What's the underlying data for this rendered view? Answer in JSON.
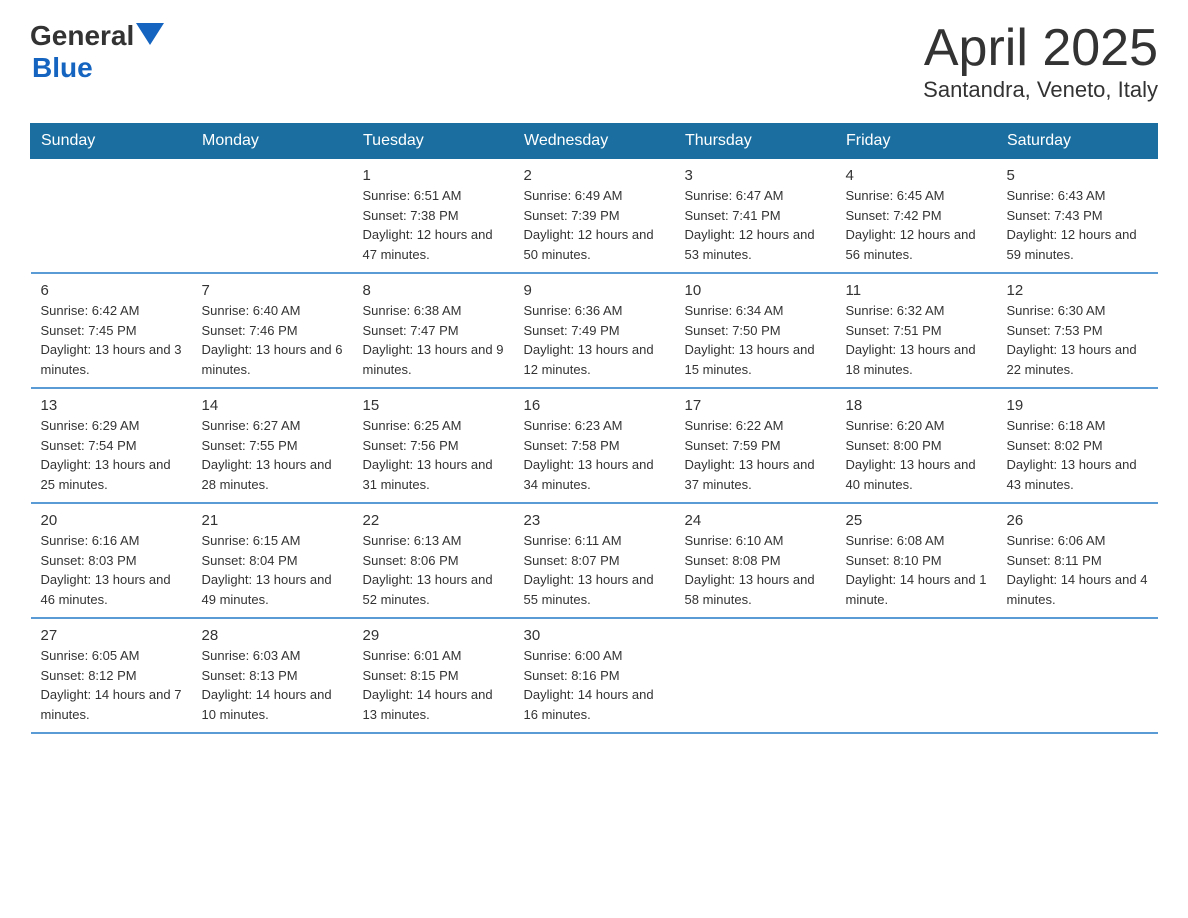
{
  "logo": {
    "general": "General",
    "blue": "Blue"
  },
  "title": "April 2025",
  "subtitle": "Santandra, Veneto, Italy",
  "headers": [
    "Sunday",
    "Monday",
    "Tuesday",
    "Wednesday",
    "Thursday",
    "Friday",
    "Saturday"
  ],
  "weeks": [
    [
      {
        "day": "",
        "sunrise": "",
        "sunset": "",
        "daylight": ""
      },
      {
        "day": "",
        "sunrise": "",
        "sunset": "",
        "daylight": ""
      },
      {
        "day": "1",
        "sunrise": "Sunrise: 6:51 AM",
        "sunset": "Sunset: 7:38 PM",
        "daylight": "Daylight: 12 hours and 47 minutes."
      },
      {
        "day": "2",
        "sunrise": "Sunrise: 6:49 AM",
        "sunset": "Sunset: 7:39 PM",
        "daylight": "Daylight: 12 hours and 50 minutes."
      },
      {
        "day": "3",
        "sunrise": "Sunrise: 6:47 AM",
        "sunset": "Sunset: 7:41 PM",
        "daylight": "Daylight: 12 hours and 53 minutes."
      },
      {
        "day": "4",
        "sunrise": "Sunrise: 6:45 AM",
        "sunset": "Sunset: 7:42 PM",
        "daylight": "Daylight: 12 hours and 56 minutes."
      },
      {
        "day": "5",
        "sunrise": "Sunrise: 6:43 AM",
        "sunset": "Sunset: 7:43 PM",
        "daylight": "Daylight: 12 hours and 59 minutes."
      }
    ],
    [
      {
        "day": "6",
        "sunrise": "Sunrise: 6:42 AM",
        "sunset": "Sunset: 7:45 PM",
        "daylight": "Daylight: 13 hours and 3 minutes."
      },
      {
        "day": "7",
        "sunrise": "Sunrise: 6:40 AM",
        "sunset": "Sunset: 7:46 PM",
        "daylight": "Daylight: 13 hours and 6 minutes."
      },
      {
        "day": "8",
        "sunrise": "Sunrise: 6:38 AM",
        "sunset": "Sunset: 7:47 PM",
        "daylight": "Daylight: 13 hours and 9 minutes."
      },
      {
        "day": "9",
        "sunrise": "Sunrise: 6:36 AM",
        "sunset": "Sunset: 7:49 PM",
        "daylight": "Daylight: 13 hours and 12 minutes."
      },
      {
        "day": "10",
        "sunrise": "Sunrise: 6:34 AM",
        "sunset": "Sunset: 7:50 PM",
        "daylight": "Daylight: 13 hours and 15 minutes."
      },
      {
        "day": "11",
        "sunrise": "Sunrise: 6:32 AM",
        "sunset": "Sunset: 7:51 PM",
        "daylight": "Daylight: 13 hours and 18 minutes."
      },
      {
        "day": "12",
        "sunrise": "Sunrise: 6:30 AM",
        "sunset": "Sunset: 7:53 PM",
        "daylight": "Daylight: 13 hours and 22 minutes."
      }
    ],
    [
      {
        "day": "13",
        "sunrise": "Sunrise: 6:29 AM",
        "sunset": "Sunset: 7:54 PM",
        "daylight": "Daylight: 13 hours and 25 minutes."
      },
      {
        "day": "14",
        "sunrise": "Sunrise: 6:27 AM",
        "sunset": "Sunset: 7:55 PM",
        "daylight": "Daylight: 13 hours and 28 minutes."
      },
      {
        "day": "15",
        "sunrise": "Sunrise: 6:25 AM",
        "sunset": "Sunset: 7:56 PM",
        "daylight": "Daylight: 13 hours and 31 minutes."
      },
      {
        "day": "16",
        "sunrise": "Sunrise: 6:23 AM",
        "sunset": "Sunset: 7:58 PM",
        "daylight": "Daylight: 13 hours and 34 minutes."
      },
      {
        "day": "17",
        "sunrise": "Sunrise: 6:22 AM",
        "sunset": "Sunset: 7:59 PM",
        "daylight": "Daylight: 13 hours and 37 minutes."
      },
      {
        "day": "18",
        "sunrise": "Sunrise: 6:20 AM",
        "sunset": "Sunset: 8:00 PM",
        "daylight": "Daylight: 13 hours and 40 minutes."
      },
      {
        "day": "19",
        "sunrise": "Sunrise: 6:18 AM",
        "sunset": "Sunset: 8:02 PM",
        "daylight": "Daylight: 13 hours and 43 minutes."
      }
    ],
    [
      {
        "day": "20",
        "sunrise": "Sunrise: 6:16 AM",
        "sunset": "Sunset: 8:03 PM",
        "daylight": "Daylight: 13 hours and 46 minutes."
      },
      {
        "day": "21",
        "sunrise": "Sunrise: 6:15 AM",
        "sunset": "Sunset: 8:04 PM",
        "daylight": "Daylight: 13 hours and 49 minutes."
      },
      {
        "day": "22",
        "sunrise": "Sunrise: 6:13 AM",
        "sunset": "Sunset: 8:06 PM",
        "daylight": "Daylight: 13 hours and 52 minutes."
      },
      {
        "day": "23",
        "sunrise": "Sunrise: 6:11 AM",
        "sunset": "Sunset: 8:07 PM",
        "daylight": "Daylight: 13 hours and 55 minutes."
      },
      {
        "day": "24",
        "sunrise": "Sunrise: 6:10 AM",
        "sunset": "Sunset: 8:08 PM",
        "daylight": "Daylight: 13 hours and 58 minutes."
      },
      {
        "day": "25",
        "sunrise": "Sunrise: 6:08 AM",
        "sunset": "Sunset: 8:10 PM",
        "daylight": "Daylight: 14 hours and 1 minute."
      },
      {
        "day": "26",
        "sunrise": "Sunrise: 6:06 AM",
        "sunset": "Sunset: 8:11 PM",
        "daylight": "Daylight: 14 hours and 4 minutes."
      }
    ],
    [
      {
        "day": "27",
        "sunrise": "Sunrise: 6:05 AM",
        "sunset": "Sunset: 8:12 PM",
        "daylight": "Daylight: 14 hours and 7 minutes."
      },
      {
        "day": "28",
        "sunrise": "Sunrise: 6:03 AM",
        "sunset": "Sunset: 8:13 PM",
        "daylight": "Daylight: 14 hours and 10 minutes."
      },
      {
        "day": "29",
        "sunrise": "Sunrise: 6:01 AM",
        "sunset": "Sunset: 8:15 PM",
        "daylight": "Daylight: 14 hours and 13 minutes."
      },
      {
        "day": "30",
        "sunrise": "Sunrise: 6:00 AM",
        "sunset": "Sunset: 8:16 PM",
        "daylight": "Daylight: 14 hours and 16 minutes."
      },
      {
        "day": "",
        "sunrise": "",
        "sunset": "",
        "daylight": ""
      },
      {
        "day": "",
        "sunrise": "",
        "sunset": "",
        "daylight": ""
      },
      {
        "day": "",
        "sunrise": "",
        "sunset": "",
        "daylight": ""
      }
    ]
  ]
}
